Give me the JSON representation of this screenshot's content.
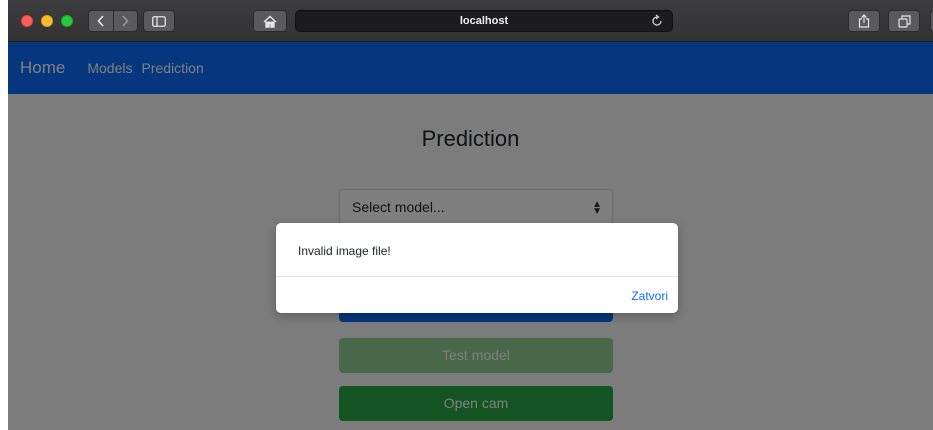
{
  "browser": {
    "url": "localhost"
  },
  "navbar": {
    "brand": "Home",
    "links": [
      "Models",
      "Prediction"
    ]
  },
  "main": {
    "title": "Prediction",
    "select_model": {
      "selected": "Select model..."
    },
    "buttons": {
      "test_model": "Test model",
      "open_cam": "Open cam"
    }
  },
  "modal": {
    "message": "Invalid image file!",
    "close_label": "Zatvori"
  },
  "colors": {
    "navbar": "#0d6efd",
    "link": "#0d6efd",
    "success": "#28a745"
  }
}
